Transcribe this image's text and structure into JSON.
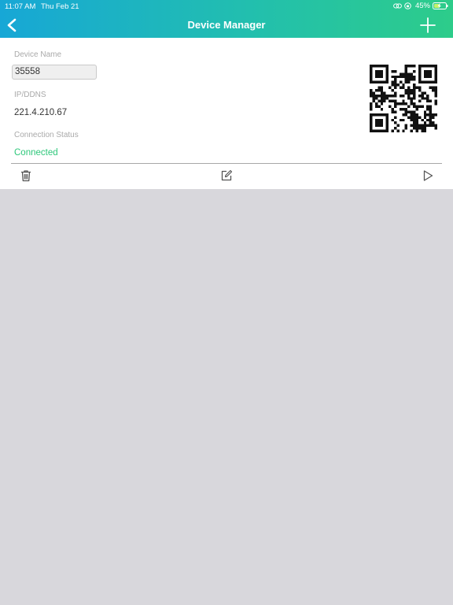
{
  "status_bar": {
    "time": "11:07 AM",
    "date": "Thu Feb 21",
    "battery": "45%"
  },
  "nav": {
    "title": "Device Manager"
  },
  "device": {
    "name_label": "Device Name",
    "name_value": "35558",
    "ip_label": "IP/DDNS",
    "ip_value": "221.4.210.67",
    "status_label": "Connection Status",
    "status_value": "Connected"
  },
  "colors": {
    "header_start": "#17a7d6",
    "header_end": "#2dcc8a",
    "connected": "#2dc77a",
    "background": "#d8d7dc"
  },
  "icons": [
    "back-arrow-icon",
    "plus-icon",
    "trash-icon",
    "edit-icon",
    "play-icon",
    "qr-code-icon"
  ]
}
